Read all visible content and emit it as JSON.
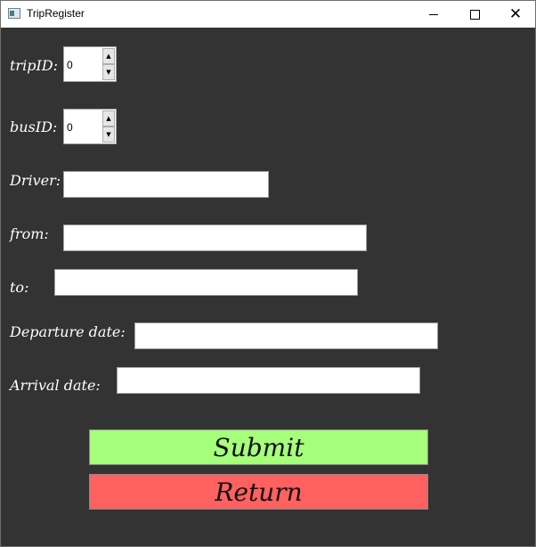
{
  "window": {
    "title": "TripRegister",
    "controls": {
      "minimize_icon": "minimize-icon",
      "maximize_icon": "maximize-icon",
      "close_icon": "close-icon"
    }
  },
  "form": {
    "tripID": {
      "label": "tripID:",
      "value": "0"
    },
    "busID": {
      "label": "busID:",
      "value": "0"
    },
    "driver": {
      "label": "Driver:",
      "value": ""
    },
    "from": {
      "label": "from:",
      "value": ""
    },
    "to": {
      "label": "to:",
      "value": ""
    },
    "departure_date": {
      "label": "Departure date:",
      "value": ""
    },
    "arrival_date": {
      "label": "Arrival date:",
      "value": ""
    }
  },
  "buttons": {
    "submit": {
      "label": "Submit",
      "color": "#a6ff7a"
    },
    "return": {
      "label": "Return",
      "color": "#ff6060"
    }
  },
  "colors": {
    "background": "#333333",
    "label_text": "#ffffff",
    "titlebar": "#ffffff"
  }
}
